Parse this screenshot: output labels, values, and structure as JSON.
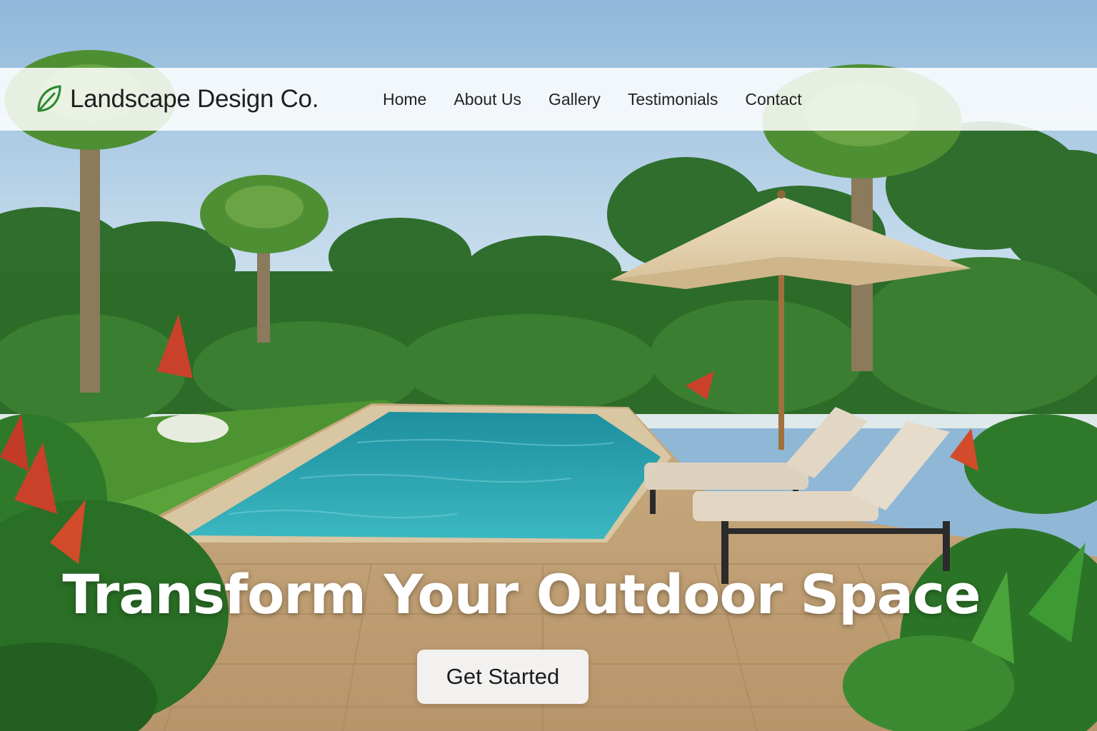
{
  "brand": {
    "name": "Landscape Design Co.",
    "logo_icon": "leaf-icon",
    "accent_color": "#2e8b2e"
  },
  "nav": {
    "items": [
      {
        "label": "Home"
      },
      {
        "label": "About Us"
      },
      {
        "label": "Gallery"
      },
      {
        "label": "Testimonials"
      },
      {
        "label": "Contact"
      }
    ]
  },
  "hero": {
    "headline": "Transform Your Outdoor Space",
    "cta_label": "Get Started"
  },
  "colors": {
    "sky": "#a8cbe6",
    "pool": "#2aa7b5",
    "foliage": "#2f7a2a",
    "paving": "#c9a87a"
  }
}
